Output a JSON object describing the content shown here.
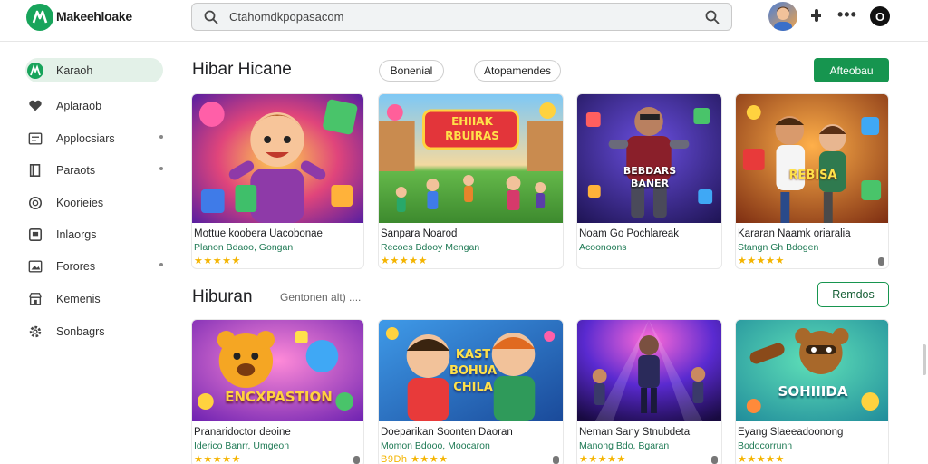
{
  "brand": {
    "name": "Makeehloake"
  },
  "search": {
    "text": "Ctahomdkpopasacom"
  },
  "sidebar": {
    "items": [
      {
        "label": "Karaoh",
        "icon": "brand-icon",
        "active": true,
        "dot": false
      },
      {
        "label": "Aplaraob",
        "icon": "heart-icon",
        "active": false,
        "dot": false
      },
      {
        "label": "Applocsiars",
        "icon": "apps-icon",
        "active": false,
        "dot": true
      },
      {
        "label": "Paraots",
        "icon": "book-icon",
        "active": false,
        "dot": true
      },
      {
        "label": "Koorieies",
        "icon": "coin-icon",
        "active": false,
        "dot": false
      },
      {
        "label": "Inlaorgs",
        "icon": "tablet-icon",
        "active": false,
        "dot": false
      },
      {
        "label": "Forores",
        "icon": "picture-icon",
        "active": false,
        "dot": true
      },
      {
        "label": "Kemenis",
        "icon": "store-icon",
        "active": false,
        "dot": false
      },
      {
        "label": "Sonbagrs",
        "icon": "gear-icon",
        "active": false,
        "dot": false
      }
    ]
  },
  "section1": {
    "title": "Hibar Hicane",
    "chips": [
      "Bonenial",
      "Atopamendes"
    ],
    "action": "Afteobau"
  },
  "section2": {
    "title": "Hiburan",
    "note": "Gentonen alt) ....",
    "action": "Remdos"
  },
  "row1": [
    {
      "title": "Mottue koobera Uacobonae",
      "sub": "Planon Bdaoo, Gongan",
      "stars": "★★★★★",
      "mark": false,
      "art": "art-hero-boy",
      "banner": ""
    },
    {
      "title": "Sanpara Noarod",
      "sub": "Recoes Bdooy Mengan",
      "stars": "★★★★★",
      "mark": false,
      "art": "art-field",
      "banner": "EHIIAK RBUIRAS"
    },
    {
      "title": "Noam Go Pochlareak",
      "sub": "Acoonoons",
      "stars": "",
      "mark": false,
      "art": "art-robot",
      "banner": "BEBDARS BANER"
    },
    {
      "title": "Kararan Naamk oriaralia",
      "sub": "Stangn Gh Bdogen",
      "stars": "★★★★★",
      "mark": true,
      "art": "art-duo",
      "banner": "REBISA"
    }
  ],
  "row2": [
    {
      "title": "Pranaridoctor deoine",
      "sub": "Iderico Banrr, Umgeon",
      "stars": "★★★★★",
      "mark": true,
      "art": "art-bear",
      "banner": "ENCXPASTION"
    },
    {
      "title": "Doeparikan Soonten Daoran",
      "sub": "Momon Bdooo, Moocaron",
      "stars": "B9Dh ★★★★",
      "mark": true,
      "art": "art-kids",
      "banner": "KAST BOHUA CHILA"
    },
    {
      "title": "Neman Sany Stnubdeta",
      "sub": "Manong Bdo, Bgaran",
      "stars": "★★★★★",
      "mark": true,
      "art": "art-dance",
      "banner": ""
    },
    {
      "title": "Eyang Slaeeadoonong",
      "sub": "Bodocorrunn",
      "stars": "★★★★★",
      "mark": false,
      "art": "art-raccoon",
      "banner": "SOHIIIDA"
    }
  ],
  "colors": {
    "accent": "#16954f",
    "active_bg": "#e3f1e8",
    "star": "#f4b400",
    "sub_text": "#1f7a55"
  }
}
